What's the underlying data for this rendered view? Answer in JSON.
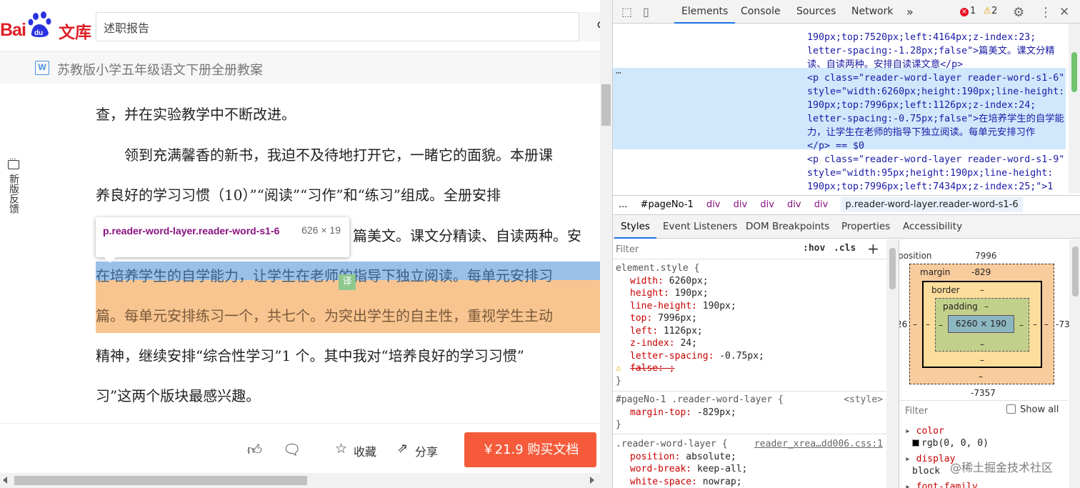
{
  "left": {
    "logo": {
      "bai": "Bai",
      "du": "du",
      "wenku": "文库"
    },
    "search": {
      "value": "述职报告",
      "button_icon": "search-icon"
    },
    "doc_title": "苏教版小学五年级语文下册全册教案",
    "doc_icon_letter": "W",
    "lines": [
      "查，并在实验教学中不断改进。",
      "　　领到充满馨香的新书，我迫不及待地打开它，一睹它的面貌。本册课",
      "养良好的学习习惯（10）”“阅读”“习作”和“练习”组成。全册安排",
      "篇美文。课文分精读、自读两种。安",
      "在培养学生的自学能力，让学生在老师的指导下独立阅读。每单元安排习",
      "篇。每单元安排练习一个，共七个。为突出学生的自主性，重视学生主动",
      "精神，继续安排“综合性学习”1 个。其中我对“培养良好的学习习惯”",
      "习”这两个版块最感兴趣。"
    ],
    "translate_chip": "译",
    "feedback": "新版反馈",
    "tooltip": {
      "selector": "p.reader-word-layer.reader-word-s1-6",
      "size": "626 × 19"
    },
    "bottom": {
      "collect": "收藏",
      "share": "分享",
      "buy": "￥21.9 购买文档"
    }
  },
  "devtools": {
    "tabs": [
      "Elements",
      "Console",
      "Sources",
      "Network"
    ],
    "errors": "1",
    "warnings": "2",
    "dom_lines": [
      {
        "text": "190px;top:7520px;left:4164px;z-index:23;"
      },
      {
        "text": "letter-spacing:-1.28px;false\">篇美文。课文分精"
      },
      {
        "text": "读、自读两种。安排自读课文意</p>"
      },
      {
        "text": "<p class=\"reader-word-layer reader-word-s1-6\""
      },
      {
        "text": "style=\"width:6260px;height:190px;line-height:"
      },
      {
        "text": "190px;top:7996px;left:1126px;z-index:24;"
      },
      {
        "text": "letter-spacing:-0.75px;false\">在培养学生的自学能"
      },
      {
        "text": "力，让学生在老师的指导下独立阅读。每单元安排习作"
      },
      {
        "text": "</p> == $0"
      },
      {
        "text": "<p class=\"reader-word-layer reader-word-s1-9\""
      },
      {
        "text": "style=\"width:95px;height:190px;line-height:"
      },
      {
        "text": "190px;top:7996px;left:7434px;z-index:25;\">1"
      }
    ],
    "breadcrumbs": [
      "...",
      "#pageNo-1",
      "div",
      "div",
      "div",
      "div",
      "div",
      "p.reader-word-layer.reader-word-s1-6"
    ],
    "sub_tabs": [
      "Styles",
      "Event Listeners",
      "DOM Breakpoints",
      "Properties",
      "Accessibility"
    ],
    "styles": {
      "filter_placeholder": "Filter",
      "hov": ":hov",
      "cls": ".cls",
      "element_style": {
        "selector": "element.style {",
        "props": [
          {
            "name": "width",
            "value": "6260px;"
          },
          {
            "name": "height",
            "value": "190px;"
          },
          {
            "name": "line-height",
            "value": "190px;"
          },
          {
            "name": "top",
            "value": "7996px;"
          },
          {
            "name": "left",
            "value": "1126px;"
          },
          {
            "name": "z-index",
            "value": "24;"
          },
          {
            "name": "letter-spacing",
            "value": "-0.75px;"
          }
        ],
        "invalid": "false: ;"
      },
      "rule2": {
        "selector": "#pageNo-1 .reader-word-layer {",
        "source": "<style>",
        "prop": "margin-top",
        "value": "-829px;"
      },
      "rule3": {
        "selector": ".reader-word-layer {",
        "source": "reader_xrea…dd006.css:1",
        "props": [
          {
            "name": "position",
            "value": "absolute;"
          },
          {
            "name": "word-break",
            "value": "keep-all;"
          },
          {
            "name": "white-space",
            "value": "nowrap;"
          }
        ]
      }
    },
    "box_model": {
      "position_label": "position",
      "position_top": "7996",
      "position_left": "26",
      "position_right": "-73",
      "position_bottom": "-7357",
      "margin_label": "margin",
      "margin_top": "-829",
      "border_label": "border",
      "padding_label": "padding",
      "dash": "–",
      "content": "6260 × 190"
    },
    "computed": {
      "filter_placeholder": "Filter",
      "show_all": "Show all",
      "props": [
        {
          "name": "color",
          "value": "rgb(0, 0, 0)"
        },
        {
          "name": "display",
          "value": "block"
        },
        {
          "name": "font-family",
          "value": ""
        }
      ]
    }
  },
  "watermark": "@稀土掘金技术社区",
  "colors": {
    "baidu_red": "#de1f26",
    "buy_orange": "#f55b3b",
    "devtools_blue": "#1a73e8",
    "highlight_blue": "#78aae1",
    "highlight_orange": "#f6b26b"
  }
}
